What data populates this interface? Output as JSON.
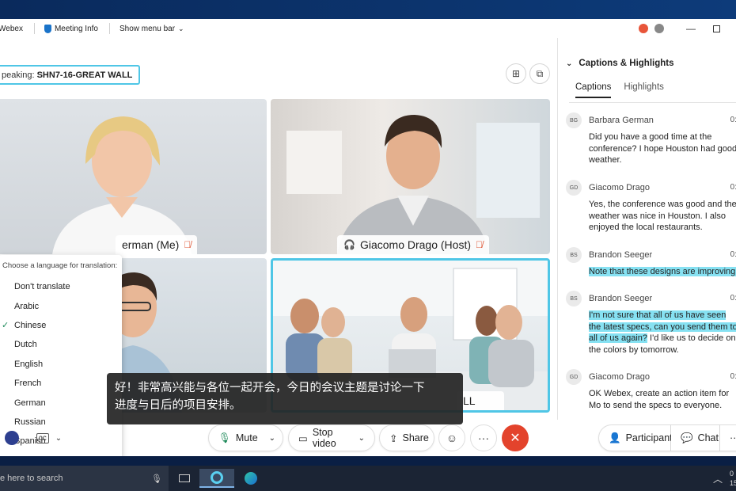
{
  "titlebar": {
    "app_name": "Webex",
    "meeting_info_label": "Meeting Info",
    "show_menu_bar_label": "Show menu bar"
  },
  "stage": {
    "speaking_label": "peaking:",
    "speaking_value": "SHN7-16-GREAT WALL"
  },
  "tiles": [
    {
      "name": "erman (Me)"
    },
    {
      "name": "Giacomo Drago (Host)"
    },
    {
      "name": ""
    },
    {
      "name": "LL"
    }
  ],
  "language_menu": {
    "title": "Choose a language for translation:",
    "selected": "Chinese",
    "items": [
      "Don't translate",
      "Arabic",
      "Chinese",
      "Dutch",
      "English",
      "French",
      "German",
      "Russian",
      "Spanish"
    ]
  },
  "caption_overlay": {
    "line1": "好！非常高兴能与各位一起开会，今日的会议主题是讨论一下",
    "line2": "进度与日后的项目安排。"
  },
  "controls": {
    "mute_label": "Mute",
    "stop_video_label": "Stop video",
    "share_label": "Share",
    "participants_label": "Participants",
    "chat_label": "Chat"
  },
  "panel": {
    "title": "Captions & Highlights",
    "tabs": [
      "Captions",
      "Highlights"
    ],
    "entries": [
      {
        "initials": "BG",
        "name": "Barbara German",
        "time": "0:",
        "text": "Did you have a good time at the conference? I hope Houston had good weather.",
        "highlight": "",
        "rest": ""
      },
      {
        "initials": "GD",
        "name": "Giacomo Drago",
        "time": "0:",
        "text": "Yes, the conference was good and the weather was nice in Houston. I also enjoyed the local restaurants.",
        "highlight": "",
        "rest": ""
      },
      {
        "initials": "BS",
        "name": "Brandon Seeger",
        "time": "0:",
        "text": "",
        "highlight": "Note that these designs are improving!",
        "rest": ""
      },
      {
        "initials": "BS",
        "name": "Brandon Seeger",
        "time": "0:",
        "text": "",
        "highlight": "I'm not sure that all of us have seen the latest specs, can you send them to all of us again?",
        "rest": " I'd like us to decide on the colors by tomorrow."
      },
      {
        "initials": "GD",
        "name": "Giacomo Drago",
        "time": "0:",
        "text": "OK Webex, create an action item for Mo to send the specs to everyone.",
        "highlight": "",
        "rest": ""
      }
    ]
  },
  "taskbar": {
    "search_placeholder": "e here to search",
    "clock_top": "0",
    "clock_bottom": "15"
  },
  "colors": {
    "accent": "#4fc6e6",
    "highlight": "#86e1f2",
    "end_call": "#e3432c",
    "mic_off": "#e05a3a"
  }
}
